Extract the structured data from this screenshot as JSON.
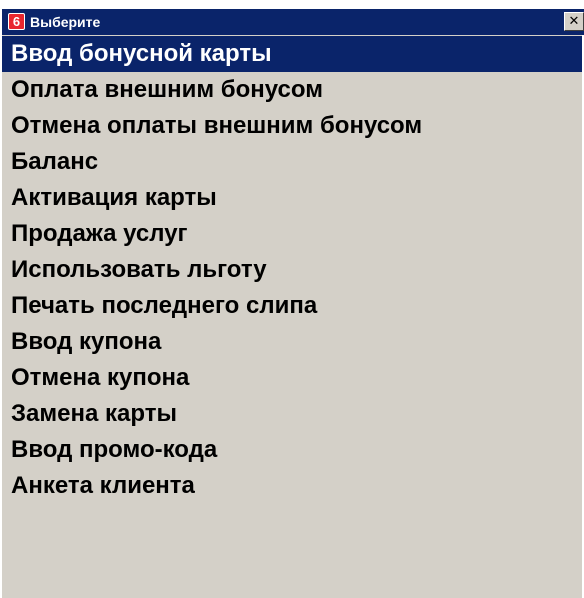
{
  "window": {
    "title": "Выберите",
    "app_icon_glyph": "6",
    "close_glyph": "✕",
    "icons": {
      "app": "app-icon",
      "close": "close-icon"
    },
    "colors": {
      "title_bar": "#0a246a",
      "selection": "#0a246a",
      "body": "#d4d0c8",
      "app_icon": "#e8262e"
    }
  },
  "menu": {
    "selected_index": 0,
    "items": [
      {
        "label": "Ввод бонусной карты"
      },
      {
        "label": "Оплата внешним бонусом"
      },
      {
        "label": "Отмена оплаты внешним бонусом"
      },
      {
        "label": "Баланс"
      },
      {
        "label": "Активация карты"
      },
      {
        "label": "Продажа услуг"
      },
      {
        "label": "Использовать льготу"
      },
      {
        "label": "Печать последнего слипа"
      },
      {
        "label": "Ввод купона"
      },
      {
        "label": "Отмена купона"
      },
      {
        "label": "Замена карты"
      },
      {
        "label": "Ввод промо-кода"
      },
      {
        "label": "Анкета клиента"
      }
    ]
  }
}
